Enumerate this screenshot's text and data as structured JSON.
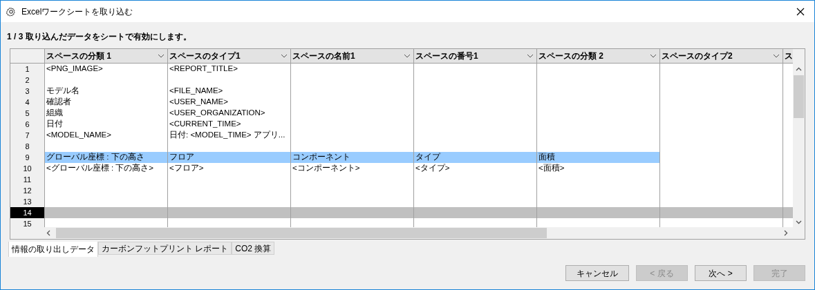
{
  "window": {
    "title": "Excelワークシートを取り込む"
  },
  "heading": "1 / 3 取り込んだデータをシートで有効にします。",
  "table": {
    "columns": [
      "スペースの分類 1",
      "スペースのタイプ1",
      "スペースの名前1",
      "スペースの番号1",
      "スペースの分類 2",
      "スペースのタイプ2",
      "ス"
    ],
    "rows": [
      {
        "number": "1",
        "selected": false,
        "cells": [
          {
            "text": "<PNG_IMAGE>",
            "highlighted": false
          },
          {
            "text": "<REPORT_TITLE>",
            "highlighted": false
          }
        ]
      },
      {
        "number": "2",
        "selected": false,
        "cells": []
      },
      {
        "number": "3",
        "selected": false,
        "cells": [
          {
            "text": "モデル名",
            "highlighted": false
          },
          {
            "text": "<FILE_NAME>",
            "highlighted": false
          }
        ]
      },
      {
        "number": "4",
        "selected": false,
        "cells": [
          {
            "text": "確認者",
            "highlighted": false
          },
          {
            "text": "<USER_NAME>",
            "highlighted": false
          }
        ]
      },
      {
        "number": "5",
        "selected": false,
        "cells": [
          {
            "text": "組織",
            "highlighted": false
          },
          {
            "text": "<USER_ORGANIZATION>",
            "highlighted": false
          }
        ]
      },
      {
        "number": "6",
        "selected": false,
        "cells": [
          {
            "text": "日付",
            "highlighted": false
          },
          {
            "text": "<CURRENT_TIME>",
            "highlighted": false
          }
        ]
      },
      {
        "number": "7",
        "selected": false,
        "cells": [
          {
            "text": "<MODEL_NAME>",
            "highlighted": false
          },
          {
            "text": "日付: <MODEL_TIME> アプリ...",
            "highlighted": false
          }
        ]
      },
      {
        "number": "8",
        "selected": false,
        "cells": []
      },
      {
        "number": "9",
        "selected": false,
        "cells": [
          {
            "text": "グローバル座標 : 下の高さ",
            "highlighted": true
          },
          {
            "text": "フロア",
            "highlighted": true
          },
          {
            "text": "コンポーネント",
            "highlighted": true
          },
          {
            "text": "タイプ",
            "highlighted": true
          },
          {
            "text": "面積",
            "highlighted": true
          }
        ]
      },
      {
        "number": "10",
        "selected": false,
        "cells": [
          {
            "text": "<グローバル座標 : 下の高さ>",
            "highlighted": false
          },
          {
            "text": "<フロア>",
            "highlighted": false
          },
          {
            "text": "<コンポーネント>",
            "highlighted": false
          },
          {
            "text": "<タイプ>",
            "highlighted": false
          },
          {
            "text": "<面積>",
            "highlighted": false
          }
        ]
      },
      {
        "number": "11",
        "selected": false,
        "cells": []
      },
      {
        "number": "12",
        "selected": false,
        "cells": []
      },
      {
        "number": "13",
        "selected": false,
        "cells": []
      },
      {
        "number": "14",
        "selected": true,
        "cells": []
      },
      {
        "number": "15",
        "selected": false,
        "cells": []
      }
    ]
  },
  "sheet_tabs": [
    {
      "label": "情報の取り出しデータ",
      "selected": true
    },
    {
      "label": "カーボンフットプリント レポート",
      "selected": false
    },
    {
      "label": "CO2 換算",
      "selected": false
    }
  ],
  "buttons": [
    {
      "label": "キャンセル",
      "disabled": false
    },
    {
      "label": "< 戻る",
      "disabled": true
    },
    {
      "label": "次へ >",
      "disabled": false
    },
    {
      "label": "完了",
      "disabled": true
    }
  ]
}
